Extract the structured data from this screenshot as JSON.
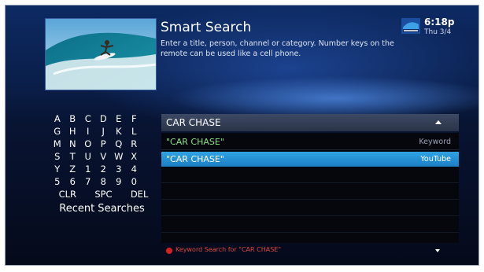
{
  "header": {
    "title": "Smart Search",
    "description": "Enter a title, person, channel or category. Number keys on the remote can be used like a cell phone.",
    "time": "6:18p",
    "date": "Thu 3/4",
    "thumbnail_icon": "surfer-image",
    "logo_icon": "directv-logo"
  },
  "keyboard": {
    "rows": [
      [
        "A",
        "B",
        "C",
        "D",
        "E",
        "F"
      ],
      [
        "G",
        "H",
        "I",
        "J",
        "K",
        "L"
      ],
      [
        "M",
        "N",
        "O",
        "P",
        "Q",
        "R"
      ],
      [
        "S",
        "T",
        "U",
        "V",
        "W",
        "X"
      ],
      [
        "Y",
        "Z",
        "1",
        "2",
        "3",
        "4"
      ],
      [
        "5",
        "6",
        "7",
        "8",
        "9",
        "0"
      ]
    ],
    "clr": "CLR",
    "spc": "SPC",
    "del": "DEL",
    "recent": "Recent Searches"
  },
  "search": {
    "query": "CAR CHASE",
    "results": [
      {
        "term": "\"CAR CHASE\"",
        "source": "Keyword",
        "selected": false
      },
      {
        "term": "\"CAR CHASE\"",
        "source": "YouTube",
        "selected": true
      }
    ]
  },
  "status": {
    "text": "Keyword Search for \"CAR CHASE\""
  },
  "colors": {
    "selected": "#1f8fd6",
    "keyword_text": "#8ee08a",
    "status_red": "#d62020"
  }
}
